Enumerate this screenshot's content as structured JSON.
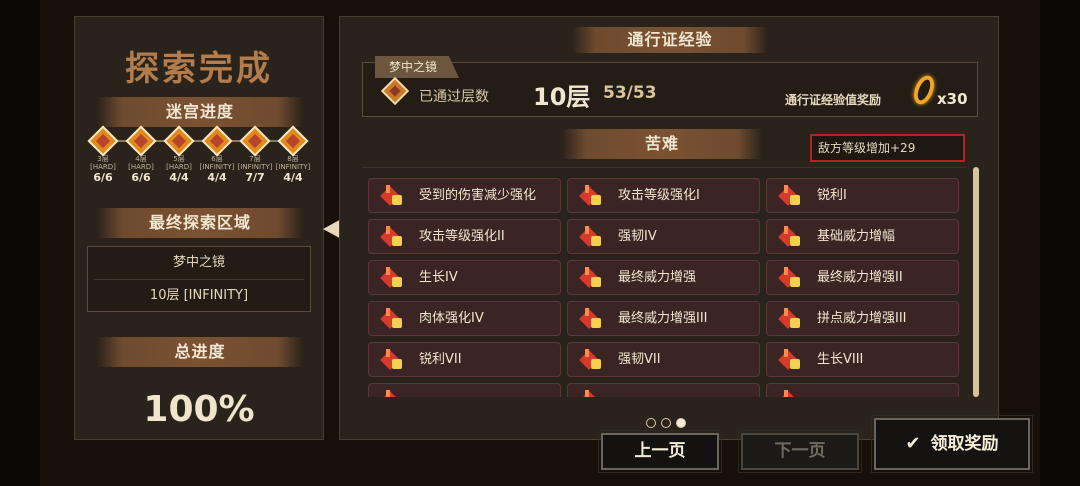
{
  "left": {
    "title": "探索完成",
    "maze_progress_label": "迷宫进度",
    "maze_nodes": [
      {
        "floor": "3层",
        "difficulty": "[HARD]",
        "count": "6/6"
      },
      {
        "floor": "4层",
        "difficulty": "[HARD]",
        "count": "6/6"
      },
      {
        "floor": "5层",
        "difficulty": "[HARD]",
        "count": "4/4"
      },
      {
        "floor": "6层",
        "difficulty": "[INFINITY]",
        "count": "4/4"
      },
      {
        "floor": "7层",
        "difficulty": "[INFINITY]",
        "count": "7/7"
      },
      {
        "floor": "8层",
        "difficulty": "[INFINITY]",
        "count": "4/4"
      }
    ],
    "final_area_label": "最终探索区域",
    "final_area_name": "梦中之镜",
    "final_area_floor": "10层 [INFINITY]",
    "total_progress_label": "总进度",
    "total_progress_value": "100%"
  },
  "right": {
    "pass_exp_title": "通行证经验",
    "dungeon_tag": "梦中之镜",
    "floors_passed_label": "已通过层数",
    "floor_value": "10层",
    "floor_count": "53/53",
    "reward_label": "通行证经验值奖励",
    "reward_count": "x30",
    "hardship_title": "苦难",
    "enemy_level_text": "敌方等级增加+29",
    "buffs": [
      [
        "受到的伤害减少强化",
        "攻击等级强化I",
        "锐利I"
      ],
      [
        "攻击等级强化II",
        "强韧IV",
        "基础威力增幅"
      ],
      [
        "生长IV",
        "最终威力增强",
        "最终威力增强II"
      ],
      [
        "肉体强化IV",
        "最终威力增强III",
        "拼点威力增强III"
      ],
      [
        "锐利VII",
        "强韧VII",
        "生长VIII"
      ]
    ],
    "page_dots": 3,
    "active_page": 3
  },
  "buttons": {
    "prev": "上一页",
    "next": "下一页",
    "claim": "领取奖励"
  },
  "colors": {
    "accent_orange": "#e08a1e",
    "enemy_box_border": "#b42222",
    "buff_bg": "#3a2524"
  }
}
